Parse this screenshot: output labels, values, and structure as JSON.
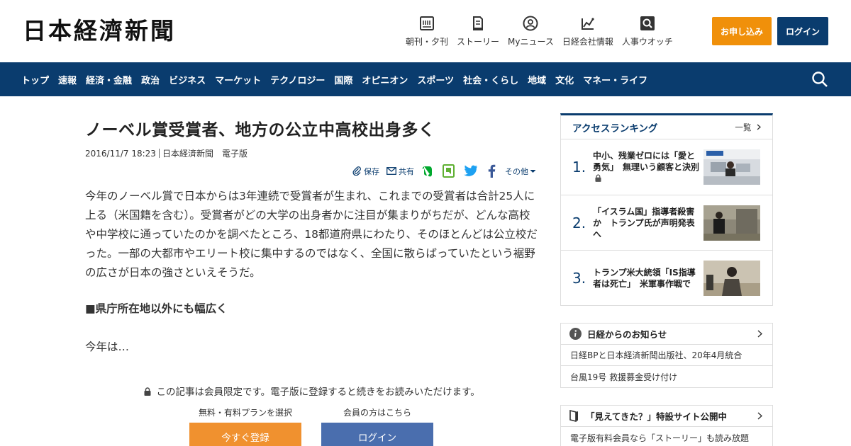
{
  "header": {
    "logo": "日本経濟新聞",
    "nav": [
      {
        "label": "朝刊・夕刊",
        "icon": "newspaper-icon"
      },
      {
        "label": "ストーリー",
        "icon": "document-icon"
      },
      {
        "label": "Myニュース",
        "icon": "person-icon"
      },
      {
        "label": "日経会社情報",
        "icon": "chart-icon"
      },
      {
        "label": "人事ウオッチ",
        "icon": "search-person-icon"
      }
    ],
    "apply_label": "お申し込み",
    "login_label": "ログイン",
    "accent": "#f0900a",
    "brand": "#0a3c6e"
  },
  "main_nav": [
    "トップ",
    "速報",
    "経済・金融",
    "政治",
    "ビジネス",
    "マーケット",
    "テクノロジー",
    "国際",
    "オピニオン",
    "スポーツ",
    "社会・くらし",
    "地域",
    "文化",
    "マネー・ライフ"
  ],
  "article": {
    "title": "ノーベル賞受賞者、地方の公立中高校出身多く",
    "date": "2016/11/7 18:23",
    "source": "日本経済新聞",
    "edition": "電子版",
    "share": {
      "save": "保存",
      "share": "共有",
      "more": "その他"
    },
    "body": "今年のノーベル賞で日本からは3年連続で受賞者が生まれ、これまでの受賞者は合計25人に上る（米国籍を含む）。受賞者がどの大学の出身者かに注目が集まりがちだが、どんな高校や中学校に通っていたのかを調べたところ、18都道府県にわたり、そのほとんどは公立校だった。一部の大都市やエリート校に集中するのではなく、全国に散らばっていたという裾野の広さが日本の強さといえそうだ。",
    "subhead": "■県庁所在地以外にも幅広く",
    "continuation": "今年は…"
  },
  "paywall": {
    "note": "この記事は会員限定です。電子版に登録すると続きをお読みいただけます。",
    "plan_caption": "無料・有料プランを選択",
    "member_caption": "会員の方はこちら",
    "register_label": "今すぐ登録",
    "login_label": "ログイン",
    "register_color": "#f0912f",
    "login_color": "#4a6eae"
  },
  "ranking": {
    "title": "アクセスランキング",
    "all_label": "一覧",
    "items": [
      {
        "rank": "1.",
        "text": "中小、残業ゼロには「愛と勇気」　無理いう顧客と決別",
        "locked": true
      },
      {
        "rank": "2.",
        "text": "「イスラム国」指導者殺害か　トランプ氏が声明発表へ",
        "locked": false
      },
      {
        "rank": "3.",
        "text": "トランプ米大統領「IS指導者は死亡」　米軍事作戦で",
        "locked": false
      }
    ]
  },
  "notices": [
    {
      "title": "日経からのお知らせ",
      "icon": "info-icon",
      "rows": [
        "日経BPと日本経済新聞出版社、20年4月統合",
        "台風19号 救援募金受け付け"
      ]
    },
    {
      "title": "「見えてきた？」特設サイト公開中",
      "icon": "bookmark-icon",
      "rows": [
        "電子版有料会員なら「ストーリー」も読み放題"
      ]
    }
  ]
}
